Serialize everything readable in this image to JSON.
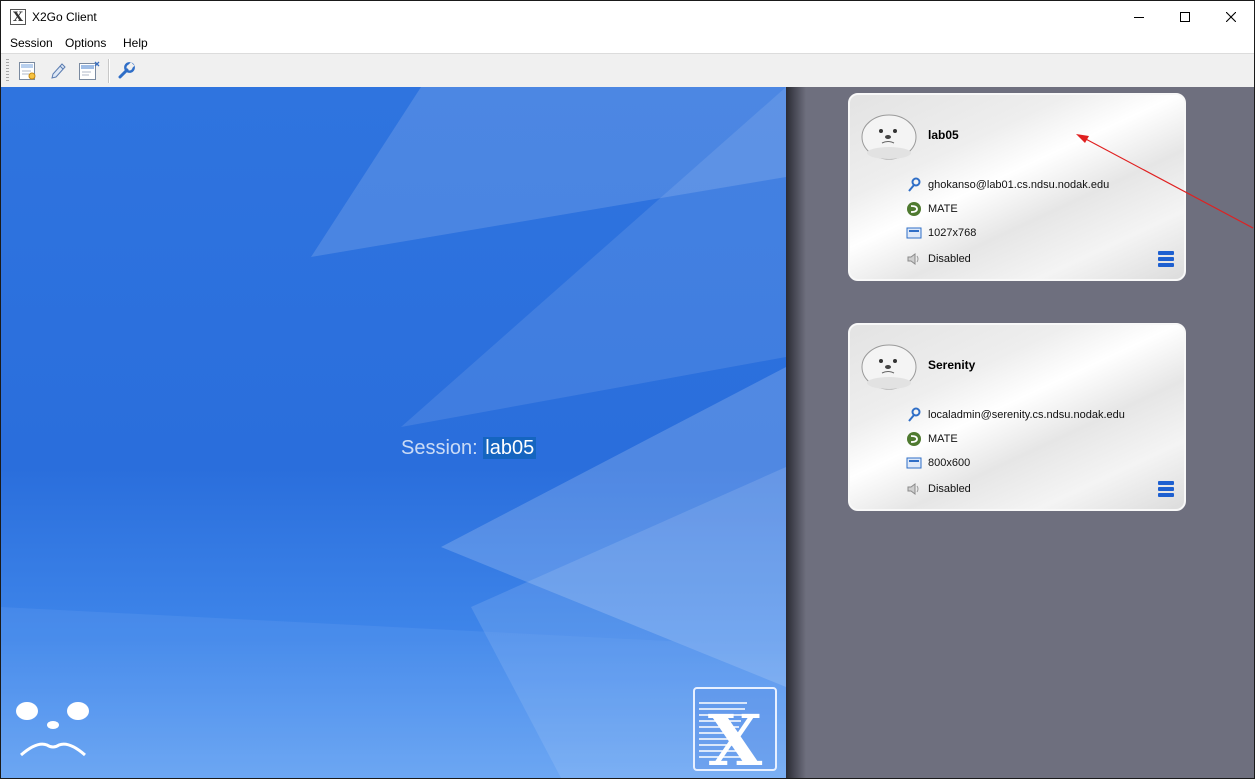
{
  "window": {
    "title": "X2Go Client",
    "app_icon_glyph": "X"
  },
  "menubar": {
    "items": [
      "Session",
      "Options",
      "Help"
    ]
  },
  "toolbar": {
    "buttons": [
      "new-session-icon",
      "edit-session-icon",
      "session-management-icon",
      "settings-wrench-icon"
    ]
  },
  "main": {
    "session_prefix": "Session:",
    "session_name": "lab05"
  },
  "sessions": [
    {
      "name": "lab05",
      "server": "ghokanso@lab01.cs.ndsu.nodak.edu",
      "desktop": "MATE",
      "resolution": "1027x768",
      "sound": "Disabled"
    },
    {
      "name": "Serenity",
      "server": "localadmin@serenity.cs.ndsu.nodak.edu",
      "desktop": "MATE",
      "resolution": "800x600",
      "sound": "Disabled"
    }
  ],
  "colors": {
    "accent": "#1d5fd0",
    "session_highlight": "#1565c0",
    "right_pane_bg": "#6e6f7e",
    "annotation": "#e02020"
  }
}
